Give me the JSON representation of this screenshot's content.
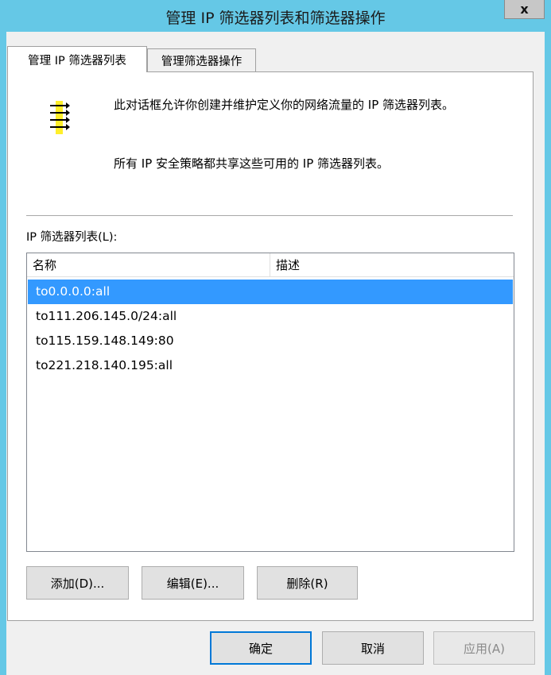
{
  "window": {
    "title": "管理 IP 筛选器列表和筛选器操作",
    "close_label": "x"
  },
  "tabs": [
    {
      "label": "管理 IP 筛选器列表",
      "active": true
    },
    {
      "label": "管理筛选器操作",
      "active": false
    }
  ],
  "panel": {
    "icon": "filter-list-icon",
    "description_line1": "此对话框允许你创建并维护定义你的网络流量的 IP 筛选器列表。",
    "description_line2": "所有 IP 安全策略都共享这些可用的 IP 筛选器列表。",
    "list_label": "IP 筛选器列表(L):",
    "columns": [
      "名称",
      "描述"
    ],
    "rows": [
      {
        "name": "to0.0.0.0:all",
        "description": "",
        "selected": true
      },
      {
        "name": "to111.206.145.0/24:all",
        "description": "",
        "selected": false
      },
      {
        "name": "to115.159.148.149:80",
        "description": "",
        "selected": false
      },
      {
        "name": "to221.218.140.195:all",
        "description": "",
        "selected": false
      }
    ],
    "buttons": {
      "add": "添加(D)...",
      "edit": "编辑(E)...",
      "delete": "删除(R)"
    }
  },
  "footer": {
    "ok": "确定",
    "cancel": "取消",
    "apply": "应用(A)",
    "apply_enabled": false
  },
  "colors": {
    "titlebar": "#65c8e6",
    "selection": "#3399ff",
    "icon_yellow": "#ffef2b"
  }
}
